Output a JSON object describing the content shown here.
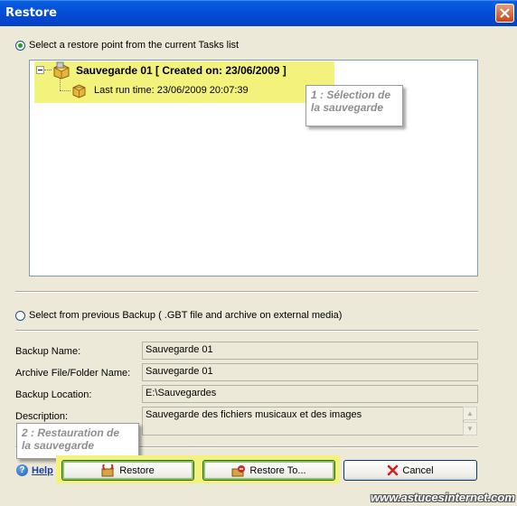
{
  "window": {
    "title": "Restore"
  },
  "restore_point": {
    "radio_label": "Select a restore point from the current Tasks list",
    "root_node": "Sauvegarde 01 [  Created on:  23/06/2009 ]",
    "child_node": "Last run time:  23/06/2009 20:07:39"
  },
  "callout1": {
    "line1": "1 : Sélection de",
    "line2": "la sauvegarde"
  },
  "previous_backup": {
    "radio_label": "Select from previous Backup ( .GBT file and archive on external media)"
  },
  "fields": {
    "backup_name_label": "Backup Name:",
    "backup_name_value": "Sauvegarde 01",
    "archive_label": "Archive File/Folder Name:",
    "archive_value": "Sauvegarde 01",
    "location_label": "Backup Location:",
    "location_value": "E:\\Sauvegardes",
    "description_label": "Description:",
    "description_value": "Sauvegarde des fichiers musicaux et des images"
  },
  "callout2": {
    "line1": "2 : Restauration de",
    "line2": "la sauvegarde"
  },
  "buttons": {
    "help": "Help",
    "restore": "Restore",
    "restore_to": "Restore To...",
    "cancel": "Cancel"
  },
  "watermark": "www.astucesinternet.com",
  "colors": {
    "highlight": "#F2F27C",
    "titlebar": "#0450D7",
    "dialog_bg": "#ECE9D8"
  }
}
